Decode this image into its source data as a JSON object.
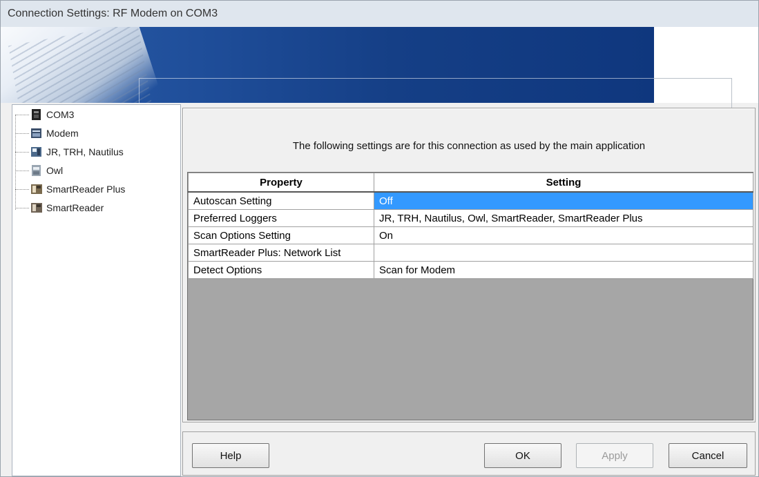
{
  "window": {
    "title": "Connection Settings: RF Modem on COM3"
  },
  "tree": {
    "items": [
      {
        "label": "COM3",
        "icon": "port-icon"
      },
      {
        "label": "Modem",
        "icon": "modem-icon"
      },
      {
        "label": "JR, TRH, Nautilus",
        "icon": "logger-icon"
      },
      {
        "label": "Owl",
        "icon": "owl-logger-icon"
      },
      {
        "label": "SmartReader Plus",
        "icon": "smartreader-plus-icon"
      },
      {
        "label": "SmartReader",
        "icon": "smartreader-icon"
      }
    ]
  },
  "panel": {
    "description": "The following settings are for this connection as used by the main application",
    "columns": [
      "Property",
      "Setting"
    ],
    "rows": [
      {
        "property": "Autoscan Setting",
        "setting": "Off"
      },
      {
        "property": "Preferred Loggers",
        "setting": "JR, TRH, Nautilus, Owl, SmartReader, SmartReader Plus"
      },
      {
        "property": "Scan Options Setting",
        "setting": "On"
      },
      {
        "property": "SmartReader Plus: Network List",
        "setting": ""
      },
      {
        "property": "Detect Options",
        "setting": "Scan for Modem"
      }
    ]
  },
  "buttons": {
    "help": "Help",
    "ok": "OK",
    "apply": "Apply",
    "cancel": "Cancel"
  },
  "colors": {
    "selection": "#3399ff",
    "banner": "#153f86"
  }
}
